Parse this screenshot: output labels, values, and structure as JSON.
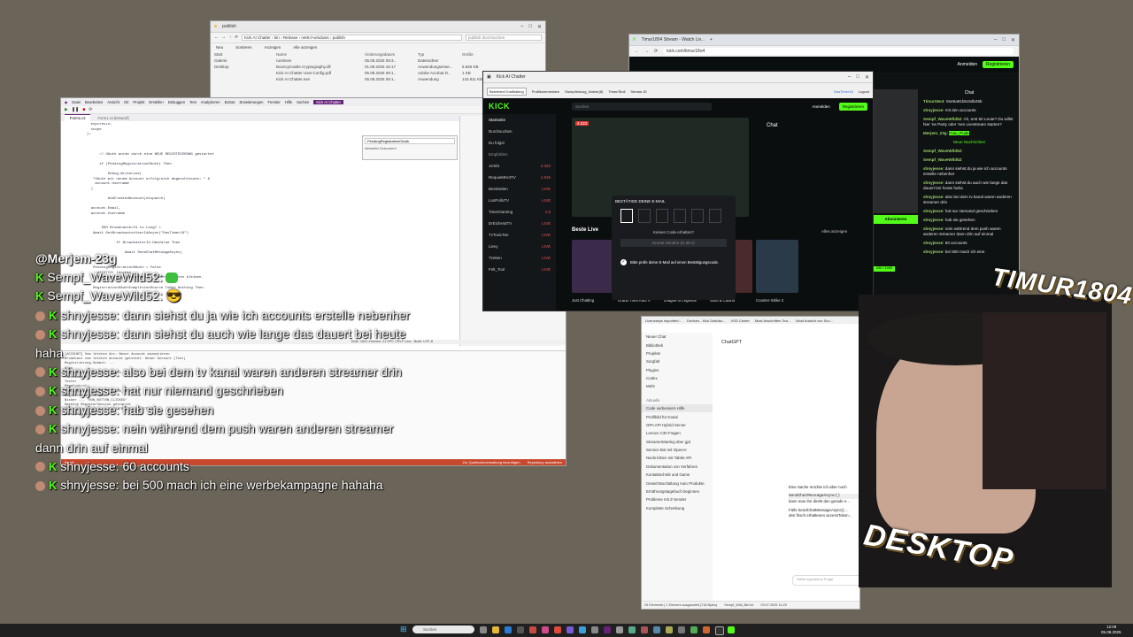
{
  "explorer": {
    "title": "publish",
    "path": [
      "Kick AI Chatter",
      "bin",
      "Release",
      "net9.0-windows",
      "publish"
    ],
    "search_placeholder": "publish durchsuchen",
    "toolbar": [
      "Neu",
      "Sortieren",
      "Anzeigen",
      "Alle anzeigen"
    ],
    "columns": [
      "Name",
      "Änderungsdatum",
      "Typ",
      "Größe"
    ],
    "files": [
      {
        "name": "runtimes",
        "date": "05.08.2025 09:3..",
        "type": "Dateiordner",
        "size": ""
      },
      {
        "name": "BouncyCastle.Cryptography.dll",
        "date": "01.08.2025 16:17",
        "type": "Anwendungserwe...",
        "size": "6.655 KB"
      },
      {
        "name": "Kick AI Chatter User.Config.pdf",
        "date": "05.08.2025 09:1..",
        "type": "Adobe Acrobat D..",
        "size": "1 KB"
      },
      {
        "name": "Kick AI Chatter.exe",
        "date": "05.08.2025 09:1..",
        "type": "Anwendung",
        "size": "143.811 KB"
      }
    ],
    "sidebar": [
      "Start",
      "Galerie",
      "Desktop"
    ]
  },
  "vs": {
    "menu": [
      "Datei",
      "Bearbeiten",
      "Ansicht",
      "Git",
      "Projekt",
      "Erstellen",
      "Debuggen",
      "Test",
      "Analysieren",
      "Extras",
      "Erweiterungen",
      "Fenster",
      "Hilfe",
      "Suchen",
      "Kick AI Chatter"
    ],
    "tabs": [
      "Form1.cs",
      "Form1.cs [Entwurf]"
    ],
    "code": "    expiresIn,\n    scope\n  );\n\n\n\n        // OAuth wurde durch eine NEUE REGISTRIERUNG gestartet\n\n        if (PendingRegistrationOAuth) Then\n\n            Debug.WriteLine(\n     \"OAuth mit neuem Account erfolgreich abgeschlossen: \" &\n      account.Username\n    )\n\n            AddCreatedAccount(dispatch)\n\n    account.Email,\n    account.Username\n\n\n         SSH BroadcasterId to Long? =\n     Await GetBroadcasterUserIdAsync(\"DasTimer18\")\n\n                If BroadcasterId.HasValue Then\n\n                    Await SendChatMessageAsync(\n\n\n     PendingRegistrationOAuth = False\n     ' WICHTIG! löschen\n     ' Kein Call für den nächsten OAuth erhalten bleiben.\n\n     RegistrationOAuthCompletionSource IsNot Nothing Then",
    "status": "Zeile: 1841  Zeichen: 21  SPC  CRLF  Leer.. Build: UTF-8",
    "find_placeholder": "PendingRegistrationOAuth",
    "find_scope": "Aktuelles Dokument",
    "output_lines": "[ACCOUNT] Vom letzten Acc: Neuer Account akzeptieren\nBroadcast vom letzten Account getestet. Neuer Account (Test)\nRegistrierung-Submit: ...\nKick\nRegistrierung fehlgeschlagen\n'ActivateAt'\nTester\nPageControl: ...\nSTATE_SESSION: 'REGISTRATION_CLICKED'\nRegistrierung: Stand\nBisher ... 'RUN_BUTTON_CLICKED'\nDesktop RegisterSession gestartet\nState-Session-Status 'REGISTRATION_SUBMITTED'\nAnmeldung-Submit: ...",
    "output_btn1": "Zur Quellcodeverwaltung hinzufügen",
    "output_btn2": "Repository auswählen",
    "output_left": "Bereit"
  },
  "kickapp": {
    "title": "Kick AI Chatter",
    "tabs": [
      "Betreiber/ChatMaking",
      "Profilkommentare",
      "Stumpfeinzug_Nutzer(8)",
      "Timer/Stoll",
      "Logout"
    ],
    "field1": "Sempf_",
    "field2": "Sempf",
    "field3": "kmed",
    "field4": "Löschen",
    "field5": "Stream-ID",
    "field6": "Neues Konto",
    "status": "DasTimer18"
  },
  "kick": {
    "search": "Suchen",
    "login_btn": "Anmelden",
    "register_btn": "Registrieren",
    "nav": [
      "Startseite",
      "Durchsuchen",
      "Du folgst"
    ],
    "section_recommended": "Empfohlen",
    "channels": [
      {
        "name": "Jvmbt",
        "count": "4.322"
      },
      {
        "name": "RequieMHotTV",
        "count": "1.916"
      },
      {
        "name": "BestSeiten",
        "count": "LIVE"
      },
      {
        "name": "LosPolloTV",
        "count": "LIVE"
      },
      {
        "name": "TimerGaming",
        "count": "1.5"
      },
      {
        "name": "DrEichHotTV",
        "count": "LIVE"
      },
      {
        "name": "TvToxicTee",
        "count": "LIVE"
      },
      {
        "name": "Lievy",
        "count": "LIVE"
      },
      {
        "name": "Tzeken",
        "count": "LIVE"
      },
      {
        "name": "Felt_Tool",
        "count": "LIVE"
      }
    ],
    "chat_title": "Chat",
    "best_live": "Beste Live",
    "show_all": "Alles anzeigen",
    "code_title": "BESTÄTIGE DEINE E-MAIL",
    "code_not_received": "Keinen Code erhalten?",
    "resend": "Erneut Senden (in 58 s)",
    "verify_hint": "Bitte prüfe deine E-Mail auf einen Bestätigungscode.",
    "categories": [
      "Just Chatting",
      "Grand Theft Auto V",
      "League of Legends",
      "Slots & Casino",
      "Counter-Strike 2"
    ],
    "live_count": "4.222"
  },
  "browser": {
    "tab": "Timur1804 Stream - Watch Liv...",
    "url": "kick.com/timur18o4",
    "login": "Anmelden",
    "register": "Registrieren",
    "chat_label": "Chat",
    "follow": "Abonnieren",
    "badge": "290 / 1000",
    "new_messages": "Neue Nachrichten",
    "messages": [
      {
        "user": "Timur18o4",
        "text": "Sse5a81b5c6db45b"
      },
      {
        "user": "shnyjesse",
        "text": "mit den accounts"
      },
      {
        "user": "Sempf_WaveWild52",
        "text": "Ah, erst 50 Leute? Du willst hier 'ne Party oder 'nen Livestream starten?"
      },
      {
        "user": "Merjem_23g",
        "text": "Frau_Punk"
      },
      {
        "user": "Sempf_WaveWild52",
        "text": ""
      },
      {
        "user": "Sempf_WaveWild52",
        "text": ""
      },
      {
        "user": "shnyjesse",
        "text": "dann siehst du ja wie ich accounts erstelle nebenher"
      },
      {
        "user": "shnyjesse",
        "text": "dann siehst du auch wie lange das dauert bei heute haha"
      },
      {
        "user": "shnyjesse",
        "text": "also bei dem tv kanal waren anderen streamer drin"
      },
      {
        "user": "shnyjesse",
        "text": "hat nur niemand geschrieben"
      },
      {
        "user": "shnyjesse",
        "text": "hab sie gesehen"
      },
      {
        "user": "shnyjesse",
        "text": "nein während dem push waren anderen streamer dann drin auf einmal"
      },
      {
        "user": "shnyjesse",
        "text": "60 accounts"
      },
      {
        "user": "shnyjesse",
        "text": "bei 500 mach ich eine"
      }
    ]
  },
  "gpt": {
    "url": "chatgpt.com/c/...",
    "bookmarks": [
      "Lizenzkeys importiert...",
      "Devices - Kick Dashbo...",
      "VSD Center",
      "Most Anschriften Tea...",
      "Most Ansicht von Sco..."
    ],
    "model": "ChatGPT",
    "nav": [
      "Neuer Chat",
      "Bibliothek",
      "Projekte",
      "Sorgfalt",
      "Plugins",
      "Codex",
      "Mehr"
    ],
    "history_label": "Aktuelle",
    "history": [
      "Code verbessern Hilfe",
      "Profilbild für Kanal",
      "GPA API Hybrid Server",
      "Lenovo C30 Fragen",
      "StreamerMarting über gpt",
      "Service Bot mit OpenAI",
      "Nachrichten mit Tablet API",
      "Dokumentation von Verfahren",
      "Kontaktschnitt und Game",
      "Gewichtsschaltung Auto Produkte",
      "Ernährungstagebuch beginnen",
      "Probleme mit Z-Sender",
      "Komplette Schreibung"
    ],
    "body_text": "Eine Sache möchte ich aber noch",
    "code_inline": "SendChatMessageAsync()",
    "body_text2": "kann man ihn direkt den gerade e...",
    "body_text3": "Falls SendChatMessageAsync() ...",
    "body_text4": "den frisch erhaltenen accessToken...",
    "prompt_placeholder": "Stelle irgendeine Frage",
    "status_left": "25 Elemente | 1 Element ausgewählt (718 Bytes)",
    "status_file": "Sempf_Wild_Birl.txt",
    "status_date": "03.07.2025 14:20",
    "status_type": "Textdokument",
    "status_size": "1 KB"
  },
  "overlay": {
    "messages": [
      {
        "user": "@Merjem-23g",
        "text": "",
        "prefix": ""
      },
      {
        "user": "Sempf_WaveWild52:",
        "text": "",
        "prefix": "K"
      },
      {
        "user": "Sempf_WaveWild52:",
        "text": "",
        "prefix": "K"
      },
      {
        "user": "shnyjesse:",
        "text": "dann siehst du ja wie ich accounts erstelle nebenher",
        "prefix": "K"
      },
      {
        "user": "shnyjesse:",
        "text": "dann siehst du auch wie lange das dauert bei heute haha",
        "prefix": "K"
      },
      {
        "user": "shnyjesse:",
        "text": "also bei dem tv kanal waren anderen streamer drin",
        "prefix": "K"
      },
      {
        "user": "shnyjesse:",
        "text": "hat nur niemand geschrieben",
        "prefix": "K"
      },
      {
        "user": "shnyjesse:",
        "text": "hab sie gesehen",
        "prefix": "K"
      },
      {
        "user": "shnyjesse:",
        "text": "nein während dem push waren anderen streamer dann drin auf einmal",
        "prefix": "K"
      },
      {
        "user": "shnyjesse:",
        "text": "60 accounts",
        "prefix": "K"
      },
      {
        "user": "shnyjesse:",
        "text": "bei 500 mach ich eine werbekampagne hahaha",
        "prefix": "K"
      }
    ]
  },
  "brand": {
    "top": "TIMUR1804",
    "bottom": "DESKTOP"
  },
  "taskbar": {
    "search_placeholder": "Suchen",
    "time": "12:09",
    "date": "05.08.2025"
  },
  "colors": {
    "kick_green": "#53fc18",
    "vs_accent": "#68217a",
    "desktop_bg": "#6b6458"
  }
}
